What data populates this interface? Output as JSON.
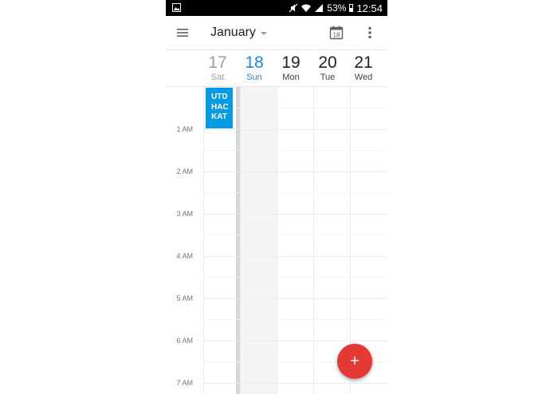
{
  "status_bar": {
    "battery_text": "53%",
    "time": "12:54",
    "icons": [
      "gallery-icon",
      "mute-icon",
      "wifi-icon",
      "signal-icon",
      "battery-icon"
    ]
  },
  "app_bar": {
    "month": "January",
    "today_icon_number": "18",
    "icons": [
      "menu-icon",
      "dropdown-caret-icon",
      "calendar-today-icon",
      "more-vert-icon"
    ]
  },
  "days": [
    {
      "number": "17",
      "name": "Sat",
      "state": "past"
    },
    {
      "number": "18",
      "name": "Sun",
      "state": "today"
    },
    {
      "number": "19",
      "name": "Mon",
      "state": "future"
    },
    {
      "number": "20",
      "name": "Tue",
      "state": "future"
    },
    {
      "number": "21",
      "name": "Wed",
      "state": "future"
    }
  ],
  "hours": [
    "1 AM",
    "2 AM",
    "3 AM",
    "4 AM",
    "5 AM",
    "6 AM",
    "7 AM"
  ],
  "event": {
    "lines": [
      "UTD",
      "HAC",
      "KAT"
    ],
    "color": "#039be5"
  },
  "fab": {
    "symbol": "+",
    "color": "#e53935",
    "icon": "add-icon"
  },
  "colors": {
    "today": "#1e88e5",
    "past": "#9e9e9e"
  }
}
